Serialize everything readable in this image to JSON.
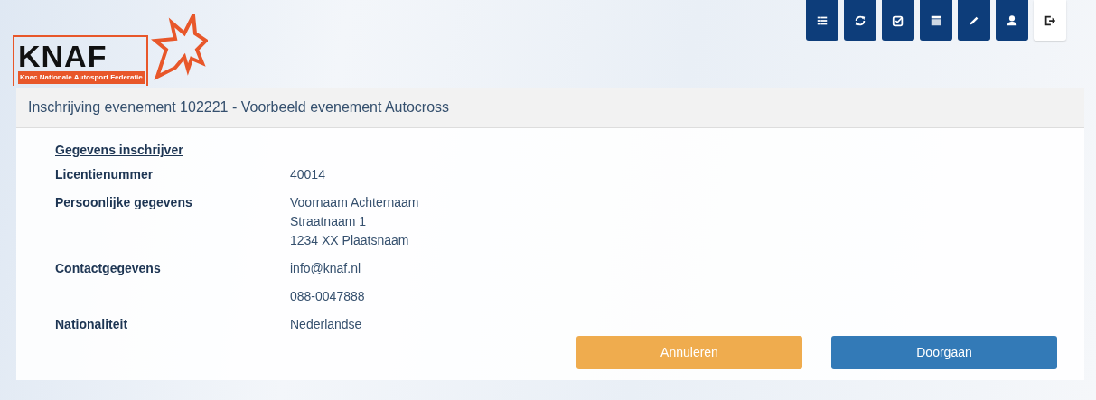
{
  "logo": {
    "name": "KNAF",
    "subtitle": "Knac Nationale Autosport Federatie"
  },
  "toolbar": [
    {
      "kind": "list",
      "selected": false
    },
    {
      "kind": "refresh",
      "selected": false
    },
    {
      "kind": "check",
      "selected": false
    },
    {
      "kind": "calendar",
      "selected": false
    },
    {
      "kind": "pencil",
      "selected": false
    },
    {
      "kind": "user",
      "selected": false
    },
    {
      "kind": "logout",
      "selected": true
    }
  ],
  "card": {
    "title": "Inschrijving evenement 102221 - Voorbeeld evenement Autocross",
    "section": "Gegevens inschrijver",
    "rows": [
      {
        "label": "Licentienummer",
        "values": [
          "40014"
        ]
      },
      {
        "label": "Persoonlijke gegevens",
        "values": [
          "Voornaam Achternaam",
          "Straatnaam 1",
          "1234 XX Plaatsnaam"
        ]
      },
      {
        "label": "Contactgegevens",
        "values": [
          "info@knaf.nl"
        ]
      },
      {
        "values": [
          "088-0047888"
        ]
      },
      {
        "label": "Nationaliteit",
        "values": [
          "Nederlandse"
        ]
      }
    ],
    "buttons": [
      {
        "label": "Annuleren",
        "kind": "cancel"
      },
      {
        "label": "Doorgaan",
        "kind": "primary"
      }
    ]
  }
}
